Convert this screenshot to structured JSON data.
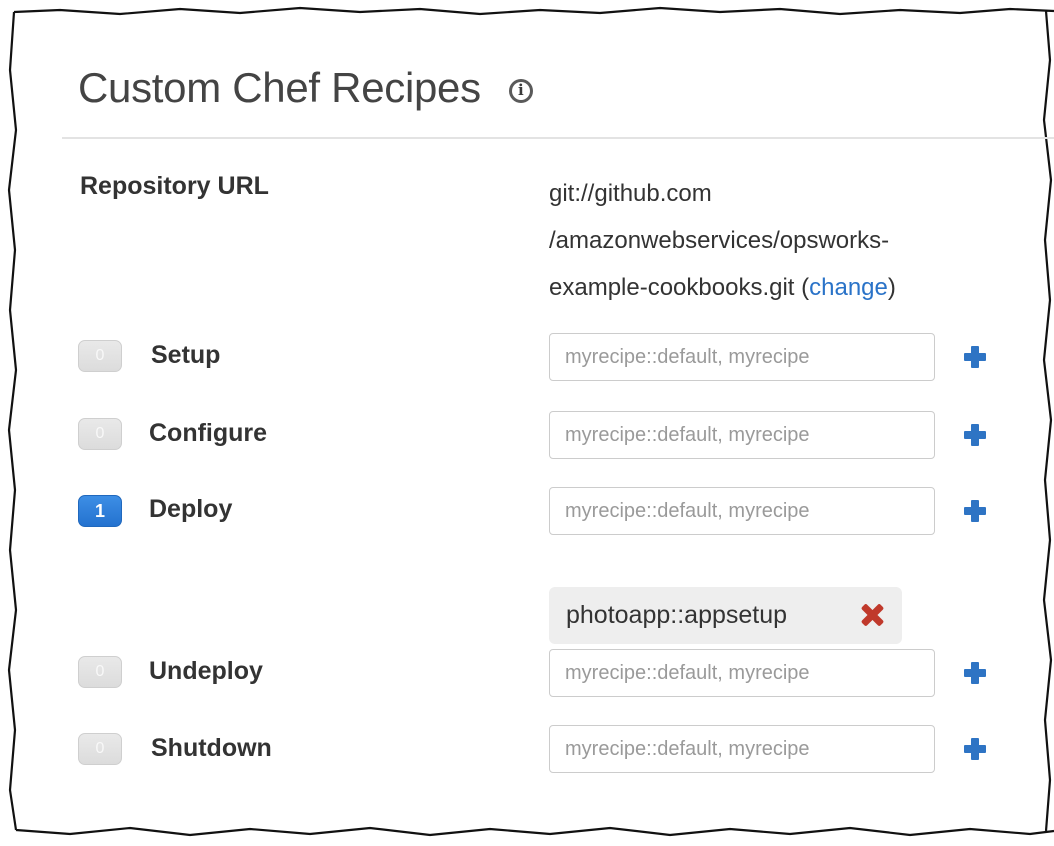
{
  "title": "Custom Chef Recipes",
  "repository": {
    "label": "Repository URL",
    "url_line1": "git://github.com",
    "url_line2": "/amazonwebservices/opsworks-",
    "url_line3": "example-cookbooks.git",
    "open_paren": " (",
    "change_link": "change",
    "close_paren": ")"
  },
  "events": [
    {
      "label": "Setup",
      "count": "0",
      "placeholder": "myrecipe::default, myrecipe"
    },
    {
      "label": "Configure",
      "count": "0",
      "placeholder": "myrecipe::default, myrecipe"
    },
    {
      "label": "Deploy",
      "count": "1",
      "placeholder": "myrecipe::default, myrecipe",
      "recipes": [
        "photoapp::appsetup"
      ]
    },
    {
      "label": "Undeploy",
      "count": "0",
      "placeholder": "myrecipe::default, myrecipe"
    },
    {
      "label": "Shutdown",
      "count": "0",
      "placeholder": "myrecipe::default, myrecipe"
    }
  ],
  "colors": {
    "accent_blue": "#2e74c4",
    "active_badge": "#2a7ad6",
    "remove_red": "#c0392b"
  },
  "icons": [
    "info-icon",
    "plus-icon",
    "remove-x-icon"
  ]
}
